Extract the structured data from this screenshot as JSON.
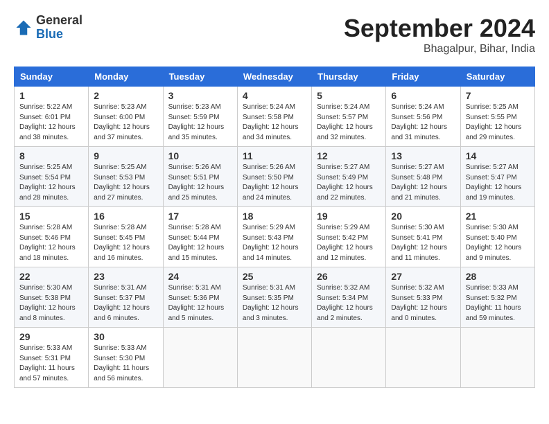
{
  "header": {
    "logo_general": "General",
    "logo_blue": "Blue",
    "month_title": "September 2024",
    "location": "Bhagalpur, Bihar, India"
  },
  "weekdays": [
    "Sunday",
    "Monday",
    "Tuesday",
    "Wednesday",
    "Thursday",
    "Friday",
    "Saturday"
  ],
  "weeks": [
    [
      {
        "day": "1",
        "info": "Sunrise: 5:22 AM\nSunset: 6:01 PM\nDaylight: 12 hours\nand 38 minutes."
      },
      {
        "day": "2",
        "info": "Sunrise: 5:23 AM\nSunset: 6:00 PM\nDaylight: 12 hours\nand 37 minutes."
      },
      {
        "day": "3",
        "info": "Sunrise: 5:23 AM\nSunset: 5:59 PM\nDaylight: 12 hours\nand 35 minutes."
      },
      {
        "day": "4",
        "info": "Sunrise: 5:24 AM\nSunset: 5:58 PM\nDaylight: 12 hours\nand 34 minutes."
      },
      {
        "day": "5",
        "info": "Sunrise: 5:24 AM\nSunset: 5:57 PM\nDaylight: 12 hours\nand 32 minutes."
      },
      {
        "day": "6",
        "info": "Sunrise: 5:24 AM\nSunset: 5:56 PM\nDaylight: 12 hours\nand 31 minutes."
      },
      {
        "day": "7",
        "info": "Sunrise: 5:25 AM\nSunset: 5:55 PM\nDaylight: 12 hours\nand 29 minutes."
      }
    ],
    [
      {
        "day": "8",
        "info": "Sunrise: 5:25 AM\nSunset: 5:54 PM\nDaylight: 12 hours\nand 28 minutes."
      },
      {
        "day": "9",
        "info": "Sunrise: 5:25 AM\nSunset: 5:53 PM\nDaylight: 12 hours\nand 27 minutes."
      },
      {
        "day": "10",
        "info": "Sunrise: 5:26 AM\nSunset: 5:51 PM\nDaylight: 12 hours\nand 25 minutes."
      },
      {
        "day": "11",
        "info": "Sunrise: 5:26 AM\nSunset: 5:50 PM\nDaylight: 12 hours\nand 24 minutes."
      },
      {
        "day": "12",
        "info": "Sunrise: 5:27 AM\nSunset: 5:49 PM\nDaylight: 12 hours\nand 22 minutes."
      },
      {
        "day": "13",
        "info": "Sunrise: 5:27 AM\nSunset: 5:48 PM\nDaylight: 12 hours\nand 21 minutes."
      },
      {
        "day": "14",
        "info": "Sunrise: 5:27 AM\nSunset: 5:47 PM\nDaylight: 12 hours\nand 19 minutes."
      }
    ],
    [
      {
        "day": "15",
        "info": "Sunrise: 5:28 AM\nSunset: 5:46 PM\nDaylight: 12 hours\nand 18 minutes."
      },
      {
        "day": "16",
        "info": "Sunrise: 5:28 AM\nSunset: 5:45 PM\nDaylight: 12 hours\nand 16 minutes."
      },
      {
        "day": "17",
        "info": "Sunrise: 5:28 AM\nSunset: 5:44 PM\nDaylight: 12 hours\nand 15 minutes."
      },
      {
        "day": "18",
        "info": "Sunrise: 5:29 AM\nSunset: 5:43 PM\nDaylight: 12 hours\nand 14 minutes."
      },
      {
        "day": "19",
        "info": "Sunrise: 5:29 AM\nSunset: 5:42 PM\nDaylight: 12 hours\nand 12 minutes."
      },
      {
        "day": "20",
        "info": "Sunrise: 5:30 AM\nSunset: 5:41 PM\nDaylight: 12 hours\nand 11 minutes."
      },
      {
        "day": "21",
        "info": "Sunrise: 5:30 AM\nSunset: 5:40 PM\nDaylight: 12 hours\nand 9 minutes."
      }
    ],
    [
      {
        "day": "22",
        "info": "Sunrise: 5:30 AM\nSunset: 5:38 PM\nDaylight: 12 hours\nand 8 minutes."
      },
      {
        "day": "23",
        "info": "Sunrise: 5:31 AM\nSunset: 5:37 PM\nDaylight: 12 hours\nand 6 minutes."
      },
      {
        "day": "24",
        "info": "Sunrise: 5:31 AM\nSunset: 5:36 PM\nDaylight: 12 hours\nand 5 minutes."
      },
      {
        "day": "25",
        "info": "Sunrise: 5:31 AM\nSunset: 5:35 PM\nDaylight: 12 hours\nand 3 minutes."
      },
      {
        "day": "26",
        "info": "Sunrise: 5:32 AM\nSunset: 5:34 PM\nDaylight: 12 hours\nand 2 minutes."
      },
      {
        "day": "27",
        "info": "Sunrise: 5:32 AM\nSunset: 5:33 PM\nDaylight: 12 hours\nand 0 minutes."
      },
      {
        "day": "28",
        "info": "Sunrise: 5:33 AM\nSunset: 5:32 PM\nDaylight: 11 hours\nand 59 minutes."
      }
    ],
    [
      {
        "day": "29",
        "info": "Sunrise: 5:33 AM\nSunset: 5:31 PM\nDaylight: 11 hours\nand 57 minutes."
      },
      {
        "day": "30",
        "info": "Sunrise: 5:33 AM\nSunset: 5:30 PM\nDaylight: 11 hours\nand 56 minutes."
      },
      {
        "day": "",
        "info": ""
      },
      {
        "day": "",
        "info": ""
      },
      {
        "day": "",
        "info": ""
      },
      {
        "day": "",
        "info": ""
      },
      {
        "day": "",
        "info": ""
      }
    ]
  ]
}
